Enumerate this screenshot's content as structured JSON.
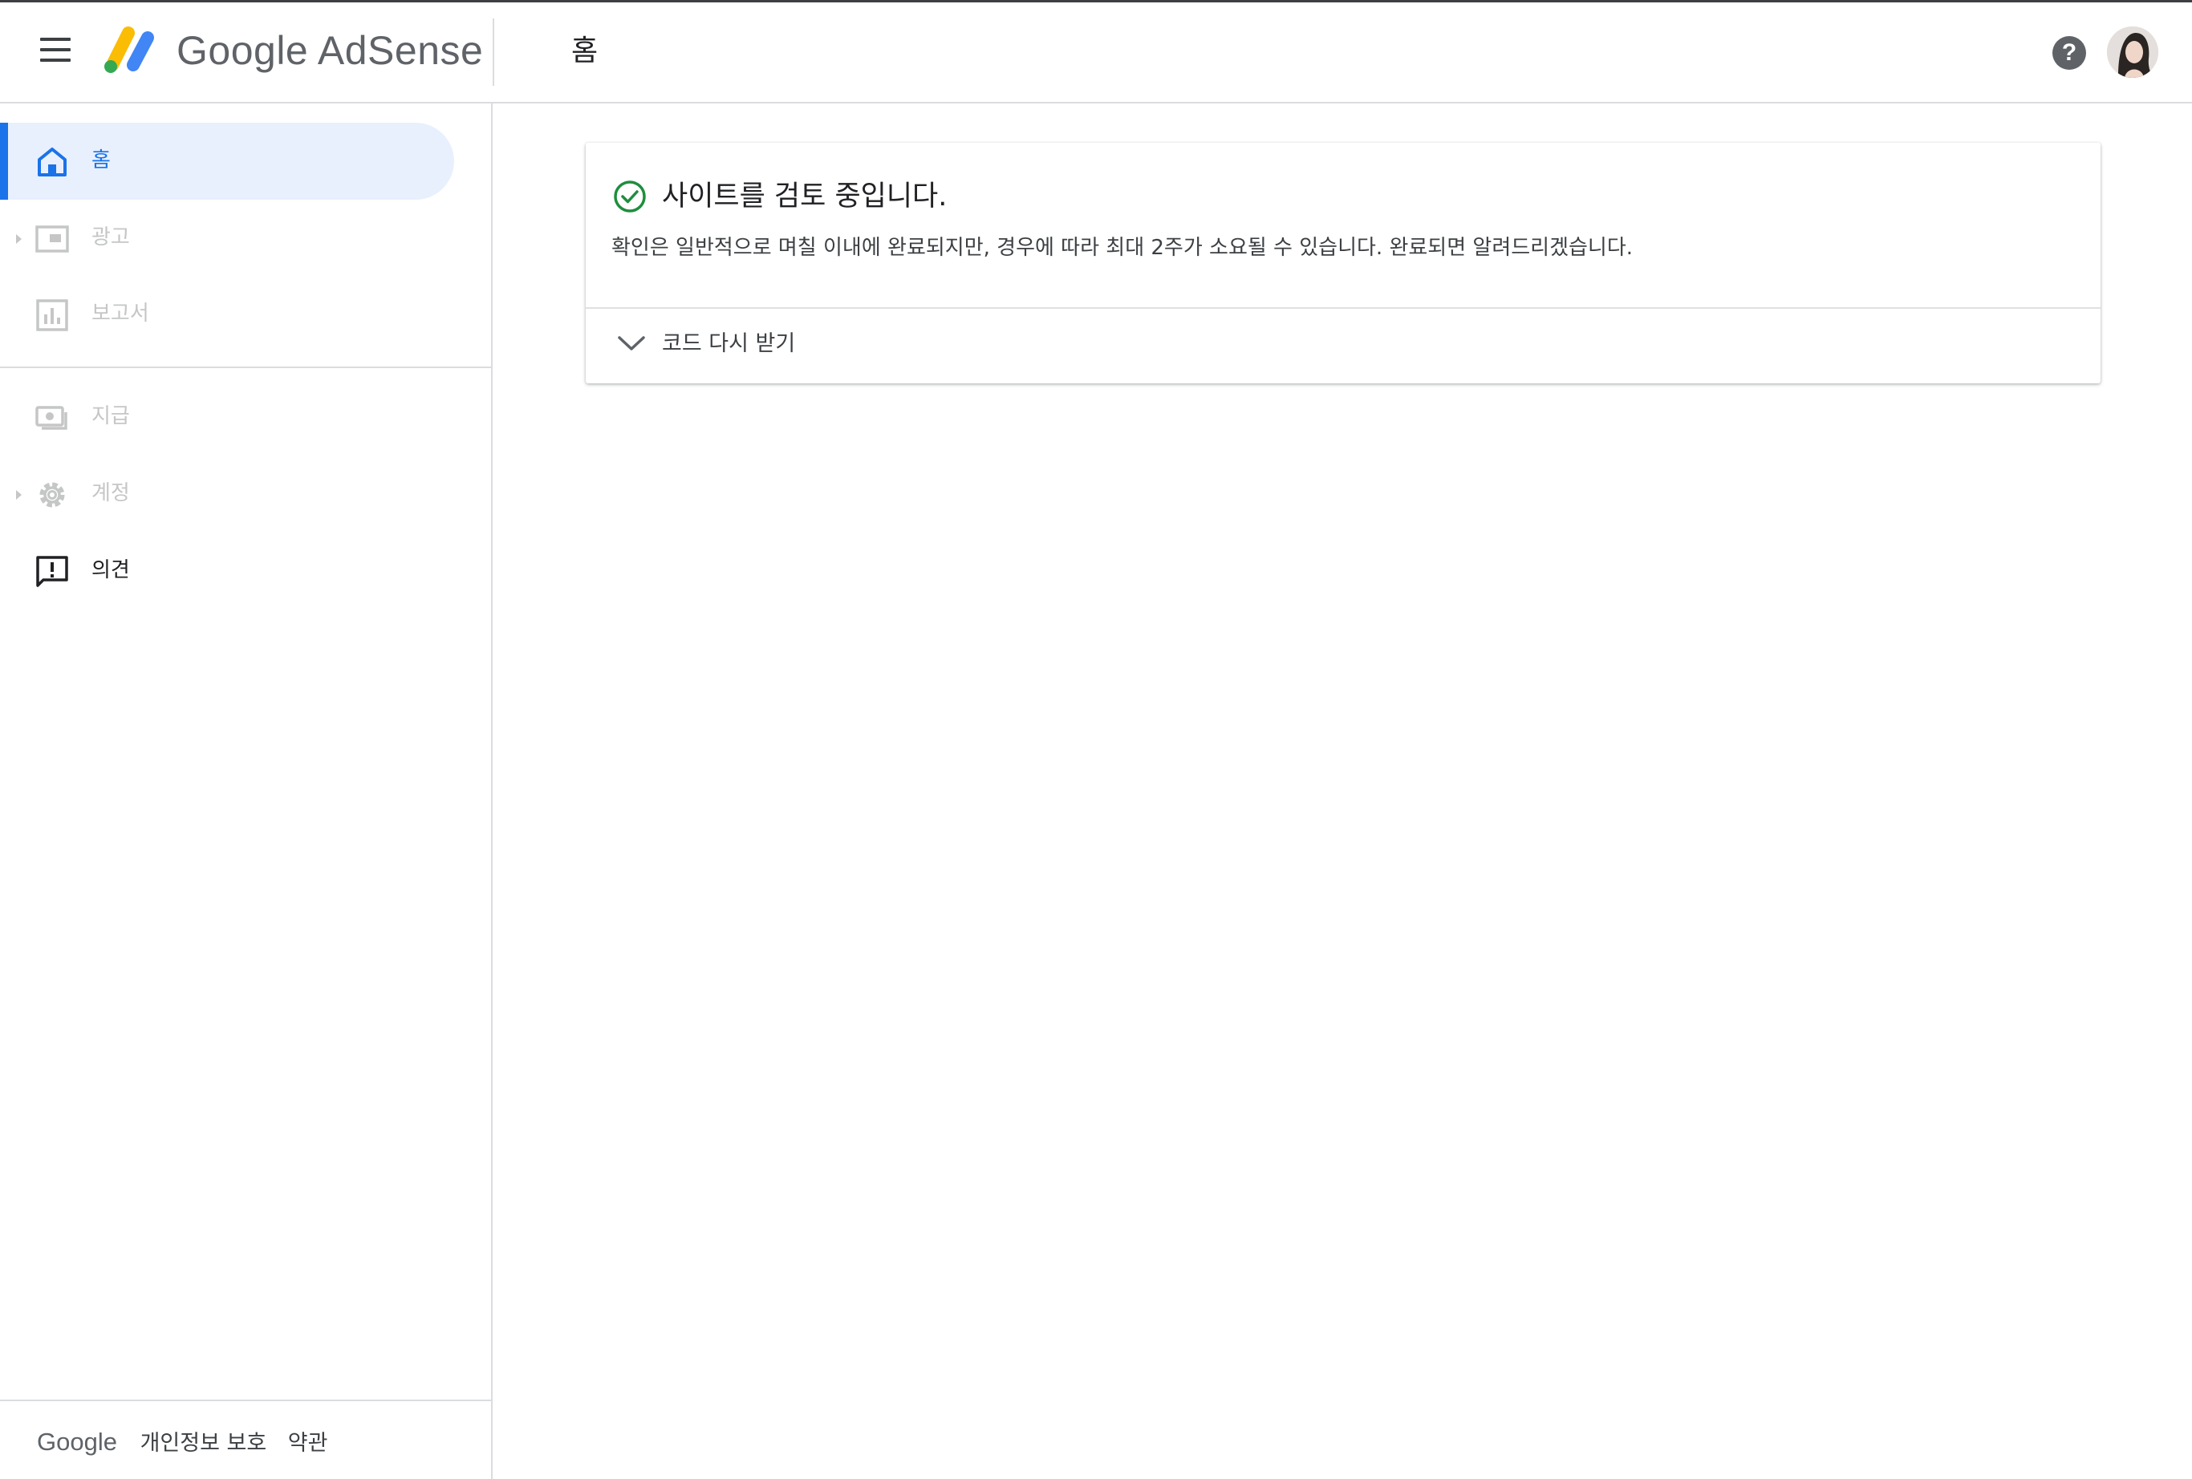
{
  "header": {
    "brand_google": "Google",
    "brand_product": "AdSense",
    "page_title": "홈",
    "help_symbol": "?"
  },
  "sidebar": {
    "items": [
      {
        "label": "홈",
        "icon": "home-icon",
        "state": "active"
      },
      {
        "label": "광고",
        "icon": "ads-icon",
        "state": "disabled",
        "expandable": true
      },
      {
        "label": "보고서",
        "icon": "reports-icon",
        "state": "disabled"
      },
      {
        "label": "지급",
        "icon": "payments-icon",
        "state": "disabled"
      },
      {
        "label": "계정",
        "icon": "gear-icon",
        "state": "disabled",
        "expandable": true
      },
      {
        "label": "의견",
        "icon": "feedback-icon",
        "state": "enabled"
      }
    ]
  },
  "footer": {
    "brand": "Google",
    "privacy": "개인정보 보호",
    "terms": "약관"
  },
  "card": {
    "title": "사이트를 검토 중입니다.",
    "body": "확인은 일반적으로 며칠 이내에 완료되지만, 경우에 따라 최대 2주가 소요될 수 있습니다. 완료되면 알려드리겠습니다.",
    "expand_label": "코드 다시 받기"
  },
  "colors": {
    "accent": "#1a73e8",
    "active_bg": "#e8f0fe",
    "success": "#1e8e3e",
    "disabled": "#c4c7c5"
  }
}
